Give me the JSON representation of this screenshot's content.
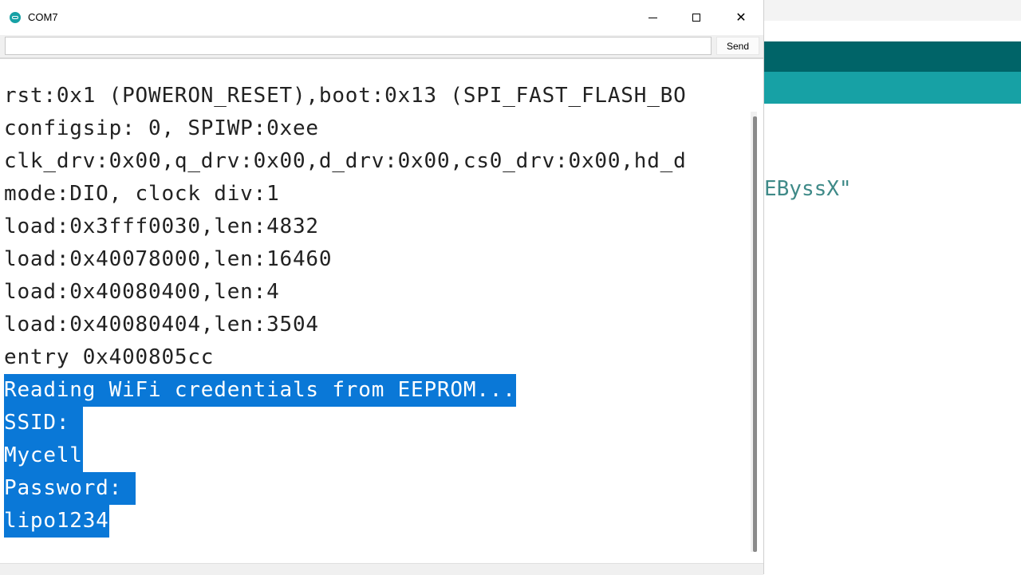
{
  "background_ide": {
    "code_fragment": "EByssX\""
  },
  "serial_monitor": {
    "title": "COM7",
    "icon": "arduino-icon",
    "send_input": {
      "value": "",
      "placeholder": ""
    },
    "send_label": "Send",
    "window_controls": {
      "minimize": "minimize-icon",
      "maximize": "maximize-icon",
      "close": "✕"
    },
    "lines": [
      {
        "text": "rst:0x1 (POWERON_RESET),boot:0x13 (SPI_FAST_FLASH_BO",
        "selected": false
      },
      {
        "text": "configsip: 0, SPIWP:0xee",
        "selected": false
      },
      {
        "text": "clk_drv:0x00,q_drv:0x00,d_drv:0x00,cs0_drv:0x00,hd_d",
        "selected": false
      },
      {
        "text": "mode:DIO, clock div:1",
        "selected": false
      },
      {
        "text": "load:0x3fff0030,len:4832",
        "selected": false
      },
      {
        "text": "load:0x40078000,len:16460",
        "selected": false
      },
      {
        "text": "load:0x40080400,len:4",
        "selected": false
      },
      {
        "text": "load:0x40080404,len:3504",
        "selected": false
      },
      {
        "text": "entry 0x400805cc",
        "selected": false
      },
      {
        "text": "Reading WiFi credentials from EEPROM...",
        "selected": true
      },
      {
        "text": "SSID: ",
        "selected": true
      },
      {
        "text": "Mycell",
        "selected": true
      },
      {
        "text": "Password: ",
        "selected": true
      },
      {
        "text": "lipo1234",
        "selected": true
      }
    ],
    "selection_color": "#0a78d7"
  }
}
